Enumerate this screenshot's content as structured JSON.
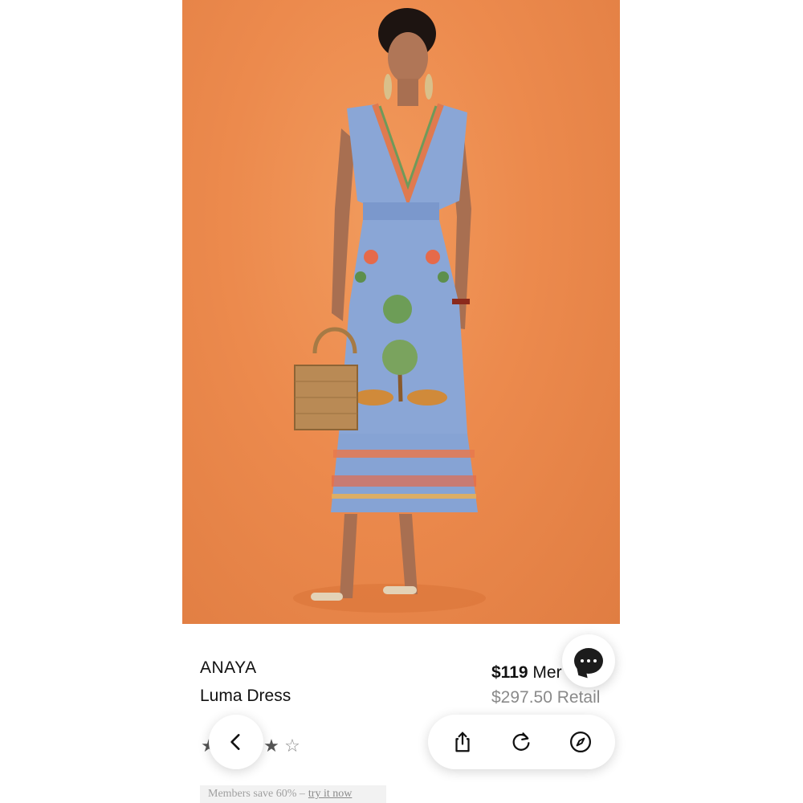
{
  "product": {
    "brand": "ANAYA",
    "name": "Luma Dress",
    "member_price": "$119",
    "member_label": "Mer",
    "retail_price": "$297.50 Retail",
    "rating": {
      "filled": 4,
      "total": 5
    }
  },
  "promo": {
    "text": "Members save 60% –",
    "link": "try it now"
  },
  "icons": {
    "chat": "chat-bubble-icon",
    "back": "chevron-left-icon",
    "share": "share-icon",
    "reload": "reload-icon",
    "compass": "compass-icon"
  },
  "colors": {
    "hero_background": "#ec8a4d",
    "dress": "#8aa6d6",
    "text_primary": "#111111",
    "text_muted": "#8a8a8a"
  }
}
